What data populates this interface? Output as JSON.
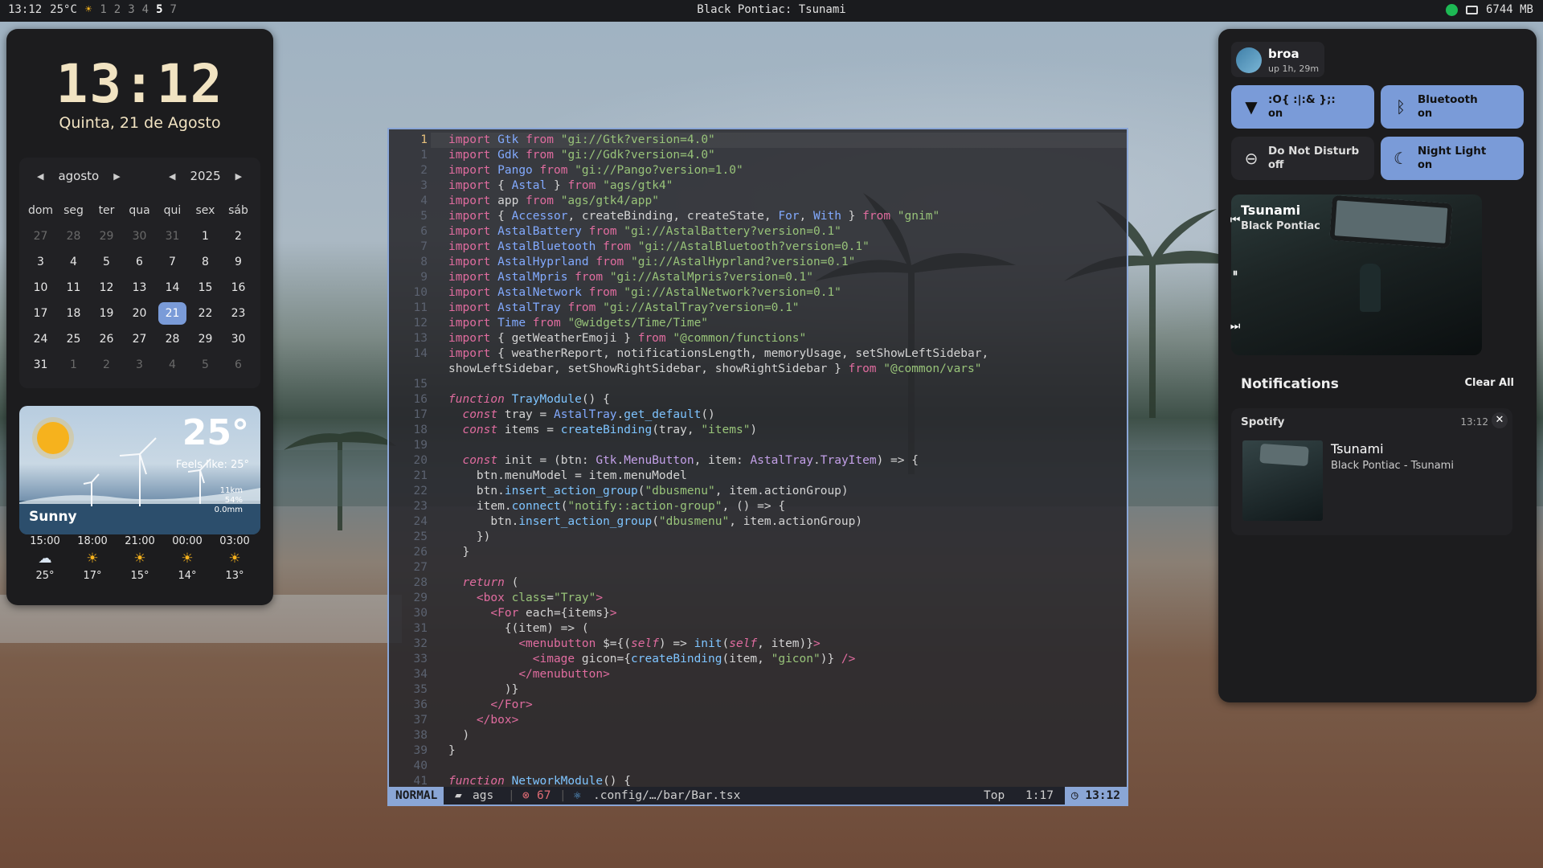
{
  "topbar": {
    "time": "13:12",
    "temp": "25°C",
    "weather_icon": "sun-icon",
    "workspaces": [
      "1",
      "2",
      "3",
      "4",
      "5",
      "7"
    ],
    "active_workspace": "5",
    "title": "Black Pontiac: Tsunami",
    "memory": "6744 MB"
  },
  "clock": {
    "time": "13:12",
    "date": "Quinta, 21 de Agosto"
  },
  "calendar": {
    "month": "agosto",
    "year": "2025",
    "weekdays": [
      "dom",
      "seg",
      "ter",
      "qua",
      "qui",
      "sex",
      "sáb"
    ],
    "weeks": [
      [
        "27",
        "28",
        "29",
        "30",
        "31",
        "1",
        "2"
      ],
      [
        "3",
        "4",
        "5",
        "6",
        "7",
        "8",
        "9"
      ],
      [
        "10",
        "11",
        "12",
        "13",
        "14",
        "15",
        "16"
      ],
      [
        "17",
        "18",
        "19",
        "20",
        "21",
        "22",
        "23"
      ],
      [
        "24",
        "25",
        "26",
        "27",
        "28",
        "29",
        "30"
      ],
      [
        "31",
        "1",
        "2",
        "3",
        "4",
        "5",
        "6"
      ]
    ],
    "today": "21"
  },
  "weather": {
    "temp": "25°",
    "feels": "Feels like: 25°",
    "condition": "Sunny",
    "wind": "11km",
    "humidity": "54%",
    "rain": "0.0mm",
    "forecast": [
      {
        "time": "15:00",
        "icon": "rain-cloud-icon",
        "temp": "25°"
      },
      {
        "time": "18:00",
        "icon": "sun-icon",
        "temp": "17°"
      },
      {
        "time": "21:00",
        "icon": "sun-icon",
        "temp": "15°"
      },
      {
        "time": "00:00",
        "icon": "sun-icon",
        "temp": "14°"
      },
      {
        "time": "03:00",
        "icon": "sun-icon",
        "temp": "13°"
      }
    ]
  },
  "editor": {
    "line_numbers": [
      "1",
      "1",
      "2",
      "3",
      "4",
      "5",
      "6",
      "7",
      "8",
      "9",
      "10",
      "11",
      "12",
      "13",
      "14",
      "",
      "15",
      "16",
      "17",
      "18",
      "19",
      "20",
      "21",
      "22",
      "23",
      "24",
      "25",
      "26",
      "27",
      "28",
      "29",
      "30",
      "31",
      "32",
      "33",
      "34",
      "35",
      "36",
      "37",
      "38",
      "39",
      "40",
      "41"
    ],
    "status": {
      "mode": "NORMAL",
      "branch": "ags",
      "errors": "67",
      "file": ".config/…/bar/Bar.tsx",
      "position": "Top",
      "cursor": "1:17",
      "time": "13:12"
    }
  },
  "right": {
    "user": {
      "name": "broa",
      "uptime": "up 1h, 29m"
    },
    "tiles": [
      {
        "title": ":O{ :|:& };:",
        "state": "on",
        "icon": "wifi-icon"
      },
      {
        "title": "Bluetooth",
        "state": "on",
        "icon": "bluetooth-icon"
      },
      {
        "title": "Do Not Disturb",
        "state": "off",
        "icon": "minus-circle-icon"
      },
      {
        "title": "Night Light",
        "state": "on",
        "icon": "moon-icon"
      }
    ],
    "player": {
      "title": "Tsunami",
      "artist": "Black Pontiac"
    },
    "notifications": {
      "header": "Notifications",
      "clear": "Clear All",
      "items": [
        {
          "app": "Spotify",
          "time": "13:12",
          "title": "Tsunami",
          "body": "Black Pontiac - Tsunami"
        }
      ]
    }
  }
}
